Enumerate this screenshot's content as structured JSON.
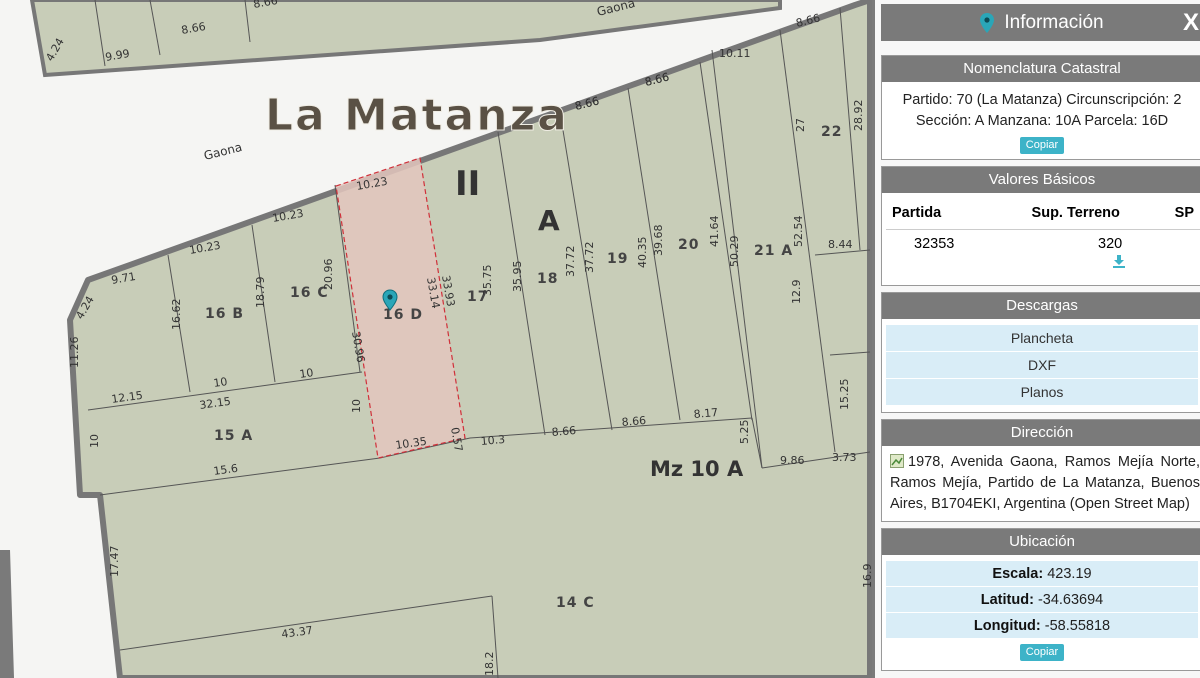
{
  "map": {
    "district_label": "La Matanza",
    "street_labels": [
      "Gaona",
      "Gaona"
    ],
    "section_labels": [
      "II",
      "A"
    ],
    "block_label": "Mz 10 A",
    "plot_labels": [
      "16 D",
      "16 C",
      "16 B",
      "15 A",
      "17",
      "18",
      "19",
      "20",
      "21 A",
      "22",
      "14 C"
    ],
    "measurements": [
      "4.24",
      "9.99",
      "8.66",
      "8.66",
      "8.66",
      "10.23",
      "10.23",
      "10.23",
      "9.71",
      "4.24",
      "11.26",
      "16.62",
      "18.79",
      "20.96",
      "30.96",
      "33.14",
      "33.93",
      "35.75",
      "35.95",
      "37.72",
      "37.72",
      "39.68",
      "40.35",
      "41.64",
      "50.29",
      "52.54",
      "27",
      "28.92",
      "8.66",
      "8.66",
      "8.66",
      "10.11",
      "8.66",
      "8.44",
      "12.9",
      "10",
      "10",
      "10",
      "12.15",
      "32.15",
      "10.35",
      "0.57",
      "10.3",
      "8.66",
      "8.66",
      "8.17",
      "5.25",
      "9.86",
      "3.73",
      "15.25",
      "15.6",
      "10",
      "17.47",
      "43.37",
      "18.2",
      "16.9"
    ]
  },
  "panel": {
    "title": "Información",
    "close_label": "X",
    "nomenclatura": {
      "title": "Nomenclatura Catastral",
      "line1": "Partido: 70 (La Matanza) Circunscripción: 2",
      "line2": "Sección: A Manzana: 10A Parcela: 16D",
      "copy_label": "Copiar"
    },
    "valores": {
      "title": "Valores Básicos",
      "headers": [
        "Partida",
        "Sup. Terreno",
        "SP"
      ],
      "row": [
        "32353",
        "320",
        ""
      ]
    },
    "descargas": {
      "title": "Descargas",
      "items": [
        "Plancheta",
        "DXF",
        "Planos"
      ]
    },
    "direccion": {
      "title": "Dirección",
      "text": "1978, Avenida Gaona, Ramos Mejía Norte, Ramos Mejía, Partido de La Matanza, Buenos Aires, B1704EKI, Argentina (Open Street Map)"
    },
    "ubicacion": {
      "title": "Ubicación",
      "escala_label": "Escala:",
      "escala_value": "423.19",
      "latitud_label": "Latitud:",
      "latitud_value": "-34.63694",
      "longitud_label": "Longitud:",
      "longitud_value": "-58.55818",
      "copy_label": "Copiar"
    }
  },
  "colors": {
    "accent": "#3db3c8",
    "panel_header": "#7a7a7a",
    "parcel_fill": "#c8cdb8",
    "selected_fill": "#e3c5bd",
    "selected_border": "#d0303a"
  }
}
